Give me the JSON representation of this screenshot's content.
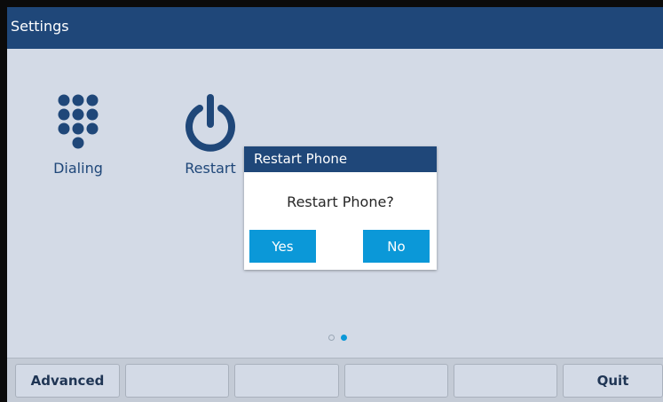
{
  "header": {
    "title": "Settings"
  },
  "apps": [
    {
      "label": "Dialing",
      "icon": "keypad-icon"
    },
    {
      "label": "Restart",
      "icon": "power-icon"
    }
  ],
  "dialog": {
    "title": "Restart Phone",
    "message": "Restart Phone?",
    "yes_label": "Yes",
    "no_label": "No"
  },
  "pager": {
    "pages": 2,
    "current": 2
  },
  "softkeys": [
    "Advanced",
    "",
    "",
    "",
    "",
    "Quit"
  ],
  "colors": {
    "header_bg": "#1f4779",
    "screen_bg": "#d3dae6",
    "accent": "#0b98d8",
    "softkey_text": "#1f3554"
  }
}
